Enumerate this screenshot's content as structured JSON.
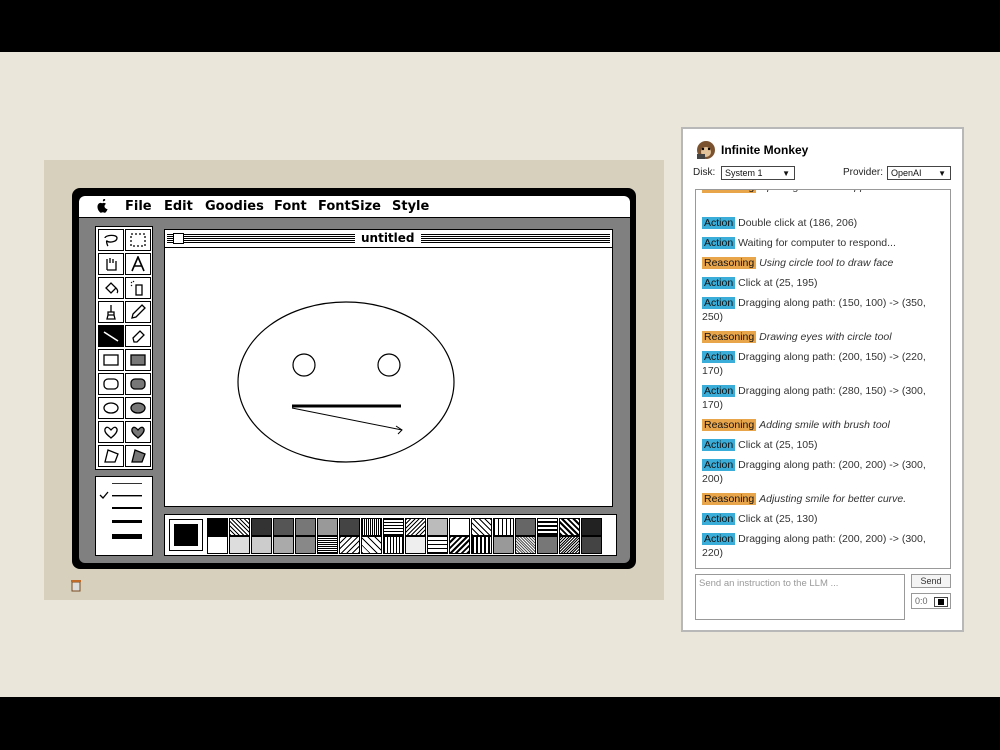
{
  "emulator": {
    "menu": {
      "apple": "apple-icon",
      "items": [
        "File",
        "Edit",
        "Goodies",
        "Font",
        "FontSize",
        "Style"
      ]
    },
    "window_title": "untitled",
    "tools": [
      "lasso",
      "marquee",
      "grabber",
      "text",
      "bucket",
      "spray",
      "brush",
      "pencil",
      "line",
      "eraser",
      "rectangle",
      "filled-rectangle",
      "rounded-rectangle",
      "filled-rounded-rectangle",
      "oval",
      "filled-oval",
      "freeform",
      "filled-freeform",
      "polygon",
      "filled-polygon"
    ],
    "selected_tool": "line"
  },
  "panel": {
    "title": "Infinite Monkey",
    "disk_label": "Disk:",
    "disk_value": "System 1",
    "provider_label": "Provider:",
    "provider_value": "OpenAI",
    "log": [
      {
        "type": "Reasoning",
        "text": "Opening MacPaint application to start."
      },
      {
        "type": "Action",
        "text": "Double click at (186, 206)"
      },
      {
        "type": "Action",
        "text": "Waiting for computer to respond..."
      },
      {
        "type": "Reasoning",
        "text": "Using circle tool to draw face"
      },
      {
        "type": "Action",
        "text": "Click at (25, 195)"
      },
      {
        "type": "Action",
        "text": "Dragging along path: (150, 100) -> (350, 250)"
      },
      {
        "type": "Reasoning",
        "text": "Drawing eyes with circle tool"
      },
      {
        "type": "Action",
        "text": "Dragging along path: (200, 150) -> (220, 170)"
      },
      {
        "type": "Action",
        "text": "Dragging along path: (280, 150) -> (300, 170)"
      },
      {
        "type": "Reasoning",
        "text": "Adding smile with brush tool"
      },
      {
        "type": "Action",
        "text": "Click at (25, 105)"
      },
      {
        "type": "Action",
        "text": "Dragging along path: (200, 200) -> (300, 200)"
      },
      {
        "type": "Reasoning",
        "text": "Adjusting smile for better curve."
      },
      {
        "type": "Action",
        "text": "Click at (25, 130)"
      },
      {
        "type": "Action",
        "text": "Dragging along path: (200, 200) -> (300, 220)"
      }
    ],
    "input_placeholder": "Send an instruction to the LLM ...",
    "send_label": "Send",
    "mini_label": "0:0"
  },
  "colors": {
    "desk": "#ebe6da",
    "action_badge": "#3aaed8",
    "reasoning_badge": "#e9a54a"
  }
}
